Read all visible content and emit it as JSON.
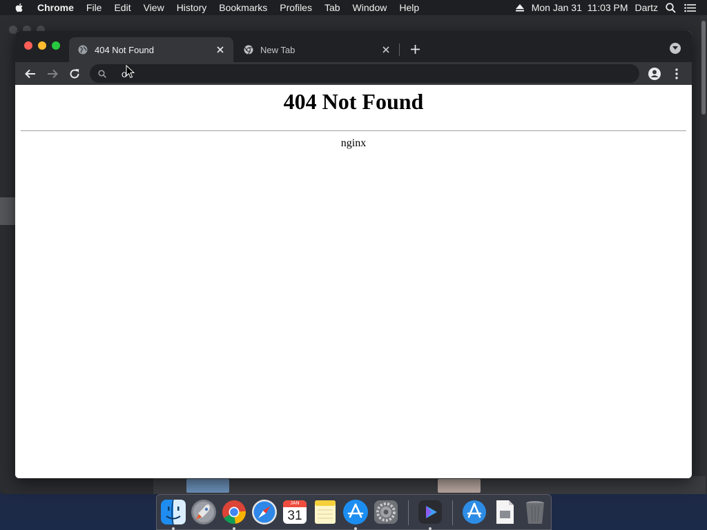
{
  "menubar": {
    "app_name": "Chrome",
    "items": [
      "File",
      "Edit",
      "View",
      "History",
      "Bookmarks",
      "Profiles",
      "Tab",
      "Window",
      "Help"
    ],
    "datetime": "Mon Jan 31  11:03 PM",
    "user": "Dartz",
    "icons": [
      "apple-icon",
      "eject-icon",
      "spotlight-search-icon",
      "control-center-icon"
    ]
  },
  "browser": {
    "tabs": [
      {
        "title": "404 Not Found",
        "icon": "globe-icon",
        "active": true
      },
      {
        "title": "New Tab",
        "icon": "chrome-icon",
        "active": false
      }
    ],
    "omnibox": {
      "value": "o",
      "placeholder": ""
    },
    "toolbar_icons": [
      "back-arrow-icon",
      "forward-arrow-icon",
      "reload-icon",
      "profile-icon",
      "kebab-menu-icon"
    ]
  },
  "page": {
    "heading": "404 Not Found",
    "server": "nginx"
  },
  "dock": {
    "apps": [
      "Finder",
      "Launchpad",
      "Google Chrome",
      "Safari",
      "Calendar",
      "Notes",
      "App Store",
      "System Preferences",
      "Video App",
      "Applications",
      "Document",
      "Trash"
    ],
    "calendar": {
      "month": "JAN",
      "day": "31"
    }
  }
}
